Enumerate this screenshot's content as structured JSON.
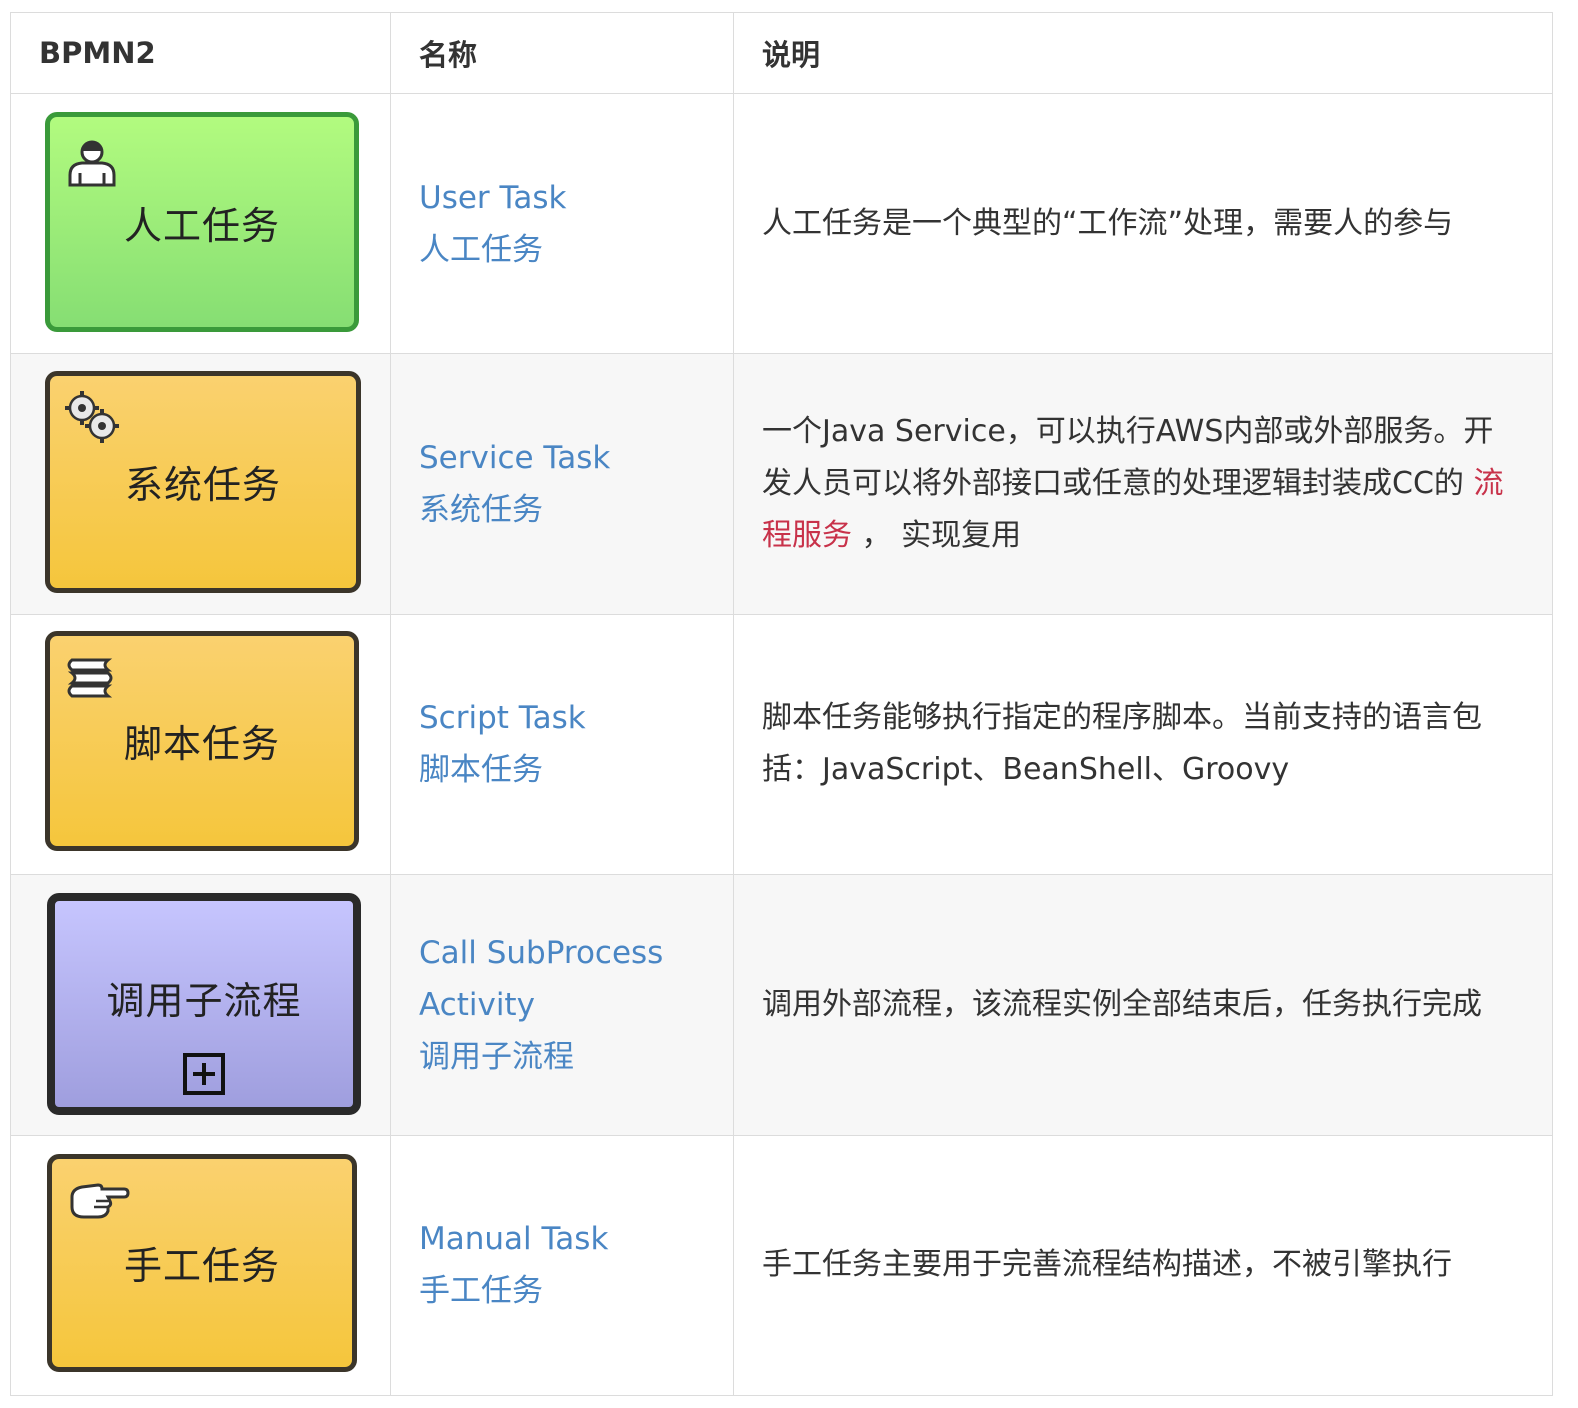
{
  "headers": {
    "col1": "BPMN2",
    "col2": "名称",
    "col3": "说明"
  },
  "rows": [
    {
      "symbol": {
        "label": "人工任务",
        "icon": "user-icon",
        "color": "#9ef07a"
      },
      "name_en": "User Task",
      "name_cn": "人工任务",
      "desc": "人工任务是一个典型的“工作流”处理，需要人的参与"
    },
    {
      "symbol": {
        "label": "系统任务",
        "icon": "gears-icon",
        "color": "#f8ca4f"
      },
      "name_en": "Service Task",
      "name_cn": "系统任务",
      "desc_pre": "一个Java Service，可以执行AWS内部或外部服务。开发人员可以将外部接口或任意的处理逻辑封装成CC的",
      "desc_link": "流程服务",
      "desc_post": "， 实现复用"
    },
    {
      "symbol": {
        "label": "脚本任务",
        "icon": "script-icon",
        "color": "#f8ca4f"
      },
      "name_en": "Script Task",
      "name_cn": "脚本任务",
      "desc": "脚本任务能够执行指定的程序脚本。当前支持的语言包括：JavaScript、BeanShell、Groovy"
    },
    {
      "symbol": {
        "label": "调用子流程",
        "icon": "expand-plus-icon",
        "color": "#b3b2f0"
      },
      "name_en": "Call SubProcess Activity",
      "name_cn": "调用子流程",
      "desc": "调用外部流程，该流程实例全部结束后，任务执行完成"
    },
    {
      "symbol": {
        "label": "手工任务",
        "icon": "hand-pointer-icon",
        "color": "#f8ca4f"
      },
      "name_en": "Manual Task",
      "name_cn": "手工任务",
      "desc": "手工任务主要用于完善流程结构描述，不被引擎执行"
    }
  ]
}
